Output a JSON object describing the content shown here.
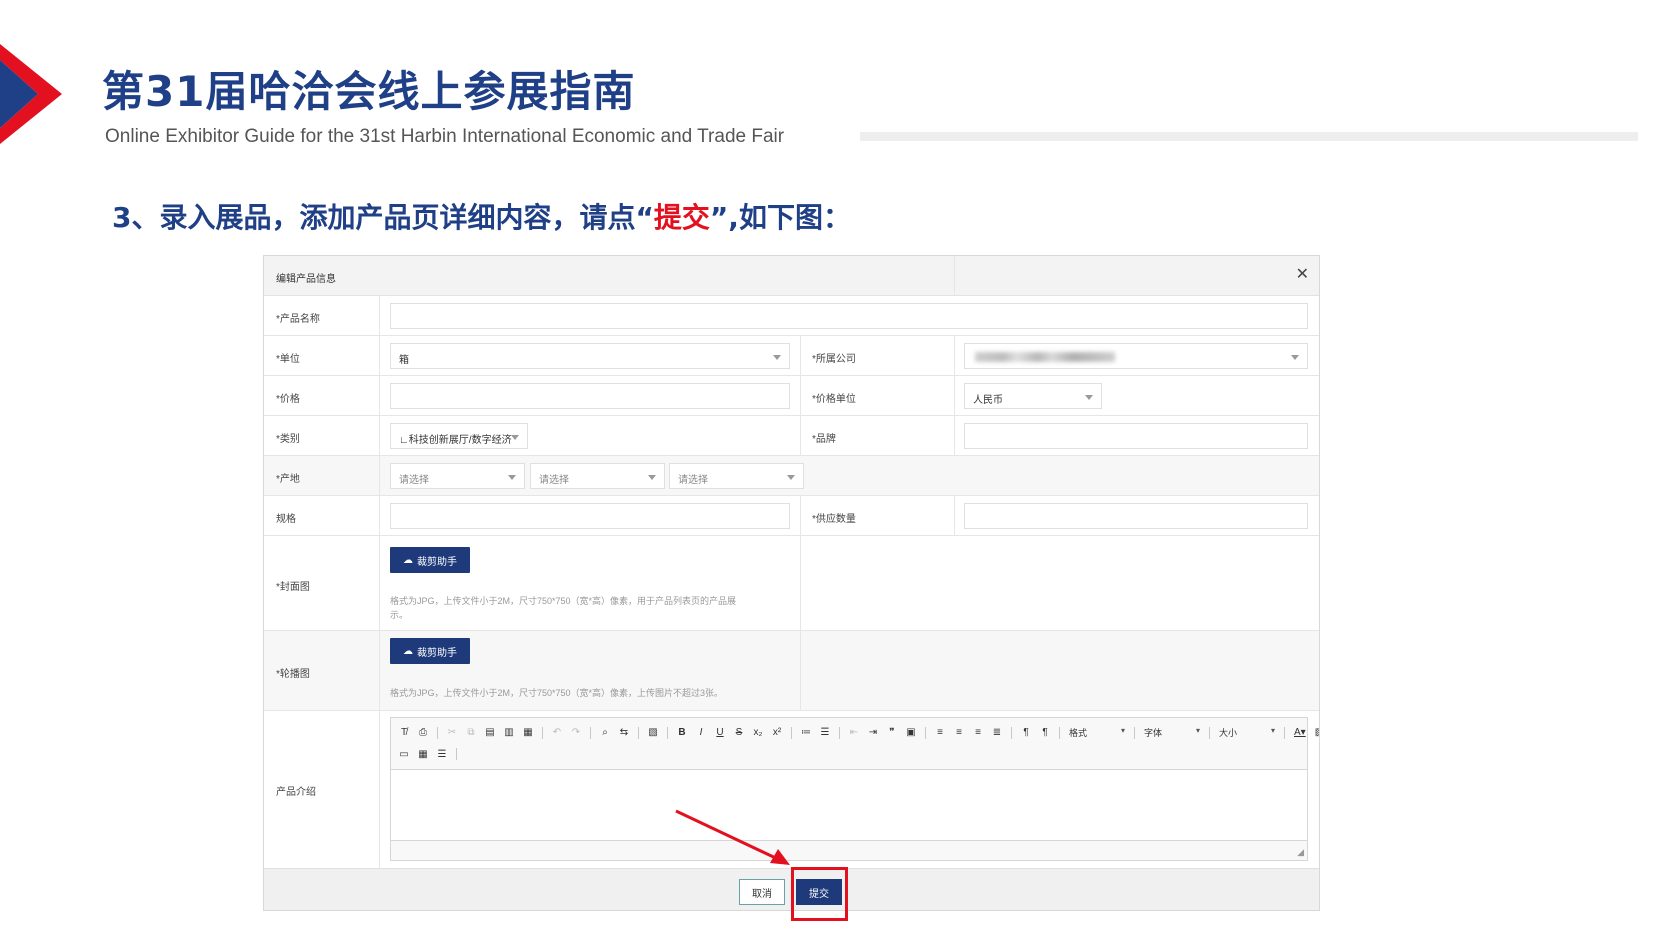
{
  "header": {
    "title": "第31届哈洽会线上参展指南",
    "subtitle": "Online Exhibitor Guide for the 31st Harbin International Economic and Trade Fair",
    "step_prefix": "3、录入展品，添加产品页详细内容，请点“",
    "step_highlight": "提交",
    "step_suffix": "”,如下图："
  },
  "colors": {
    "brand_blue": "#1f3f87",
    "accent_red": "#e3101f",
    "button_blue": "#1e3a7a"
  },
  "dialog": {
    "title": "编辑产品信息",
    "close_icon": "close-icon",
    "fields": {
      "product_name_label": "*产品名称",
      "unit_label": "*单位",
      "unit_value": "箱",
      "company_label": "*所属公司",
      "price_label": "*价格",
      "price_unit_label": "*价格单位",
      "price_unit_value": "人民币",
      "category_label": "*类别",
      "category_value": "∟科技创新展厅/数字经济",
      "brand_label": "*品牌",
      "origin_label": "*产地",
      "origin_placeholders": [
        "请选择",
        "请选择",
        "请选择"
      ],
      "spec_label": "规格",
      "supply_label": "*供应数量",
      "cover_label": "*封面图",
      "cover_button": "裁剪助手",
      "cover_hint_1": "格式为JPG，上传文件小于2M，尺寸750*750（宽*高）像素，用于产品列表页的产品展",
      "cover_hint_2": "示。",
      "carousel_label": "*轮播图",
      "carousel_button": "裁剪助手",
      "carousel_hint": "格式为JPG，上传文件小于2M，尺寸750*750（宽*高）像素，上传图片不超过3张。",
      "intro_label": "产品介绍"
    },
    "toolbar": {
      "format": "格式",
      "font": "字体",
      "size": "大小"
    },
    "buttons": {
      "cancel": "取消",
      "submit": "提交"
    }
  }
}
